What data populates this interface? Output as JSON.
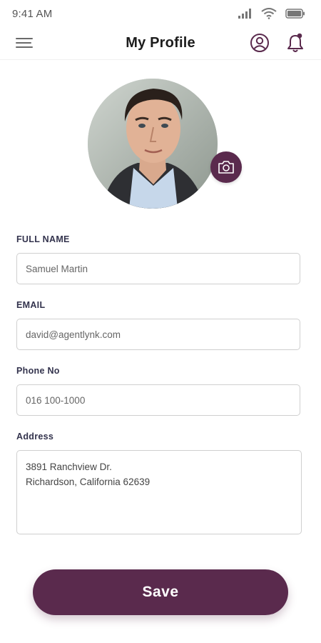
{
  "status_bar": {
    "time": "9:41 AM"
  },
  "header": {
    "title": "My Profile",
    "icons": {
      "menu": "hamburger-menu-icon",
      "profile": "user-circle-icon",
      "notifications": "bell-icon"
    }
  },
  "avatar": {
    "edit_icon": "camera-icon"
  },
  "form": {
    "full_name": {
      "label": "FULL NAME",
      "value": "Samuel Martin"
    },
    "email": {
      "label": "EMAIL",
      "value": "david@agentlynk.com"
    },
    "phone": {
      "label": "Phone No",
      "value": "016 100-1000"
    },
    "address": {
      "label": "Address",
      "line1": "3891 Ranchview Dr.",
      "line2": "Richardson, California 62639"
    }
  },
  "save_button": {
    "label": "Save"
  },
  "colors": {
    "accent": "#5a2a4d",
    "notification_dot": "#5a2a4d",
    "input_border": "#cfcfcf"
  }
}
